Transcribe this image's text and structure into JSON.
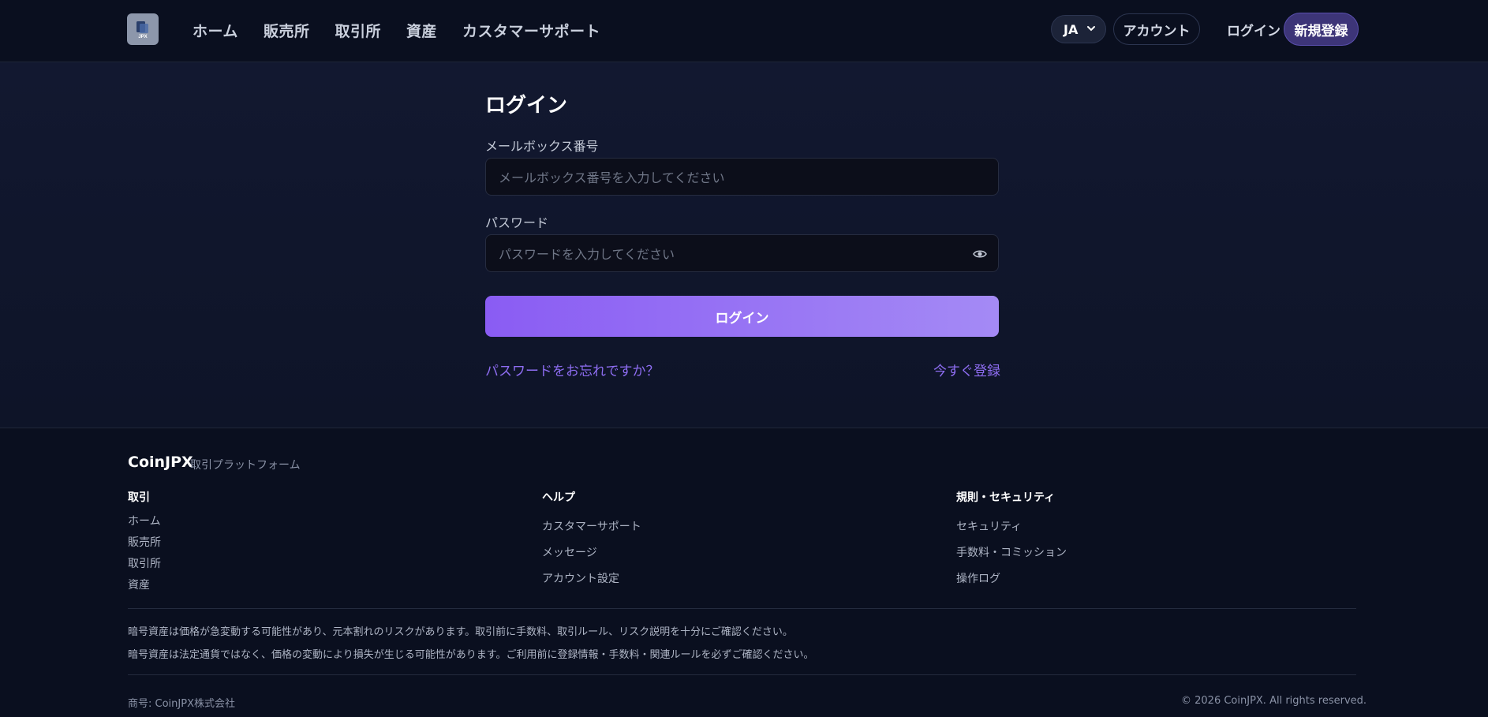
{
  "header": {
    "logo_text": "JPX",
    "nav": [
      "ホーム",
      "販売所",
      "取引所",
      "資産",
      "カスタマーサポート"
    ],
    "language": "JA",
    "account_label": "アカウント",
    "login_label": "ログイン",
    "register_label": "新規登録"
  },
  "login": {
    "title": "ログイン",
    "email_label": "メールボックス番号",
    "email_placeholder": "メールボックス番号を入力してください",
    "password_label": "パスワード",
    "password_placeholder": "パスワードを入力してください",
    "submit_label": "ログイン",
    "forgot_label": "パスワードをお忘れですか？",
    "signup_label": "今すぐ登録"
  },
  "footer": {
    "brand": "CoinJPX",
    "brand_sub": "取引プラットフォーム",
    "col1": {
      "title": "取引",
      "items": [
        "ホーム",
        "販売所",
        "取引所",
        "資産"
      ]
    },
    "col2": {
      "title": "ヘルプ",
      "items": [
        "カスタマーサポート",
        "メッセージ",
        "アカウント設定"
      ]
    },
    "col3": {
      "title": "規則・セキュリティ",
      "items": [
        "セキュリティ",
        "手数料・コミッション",
        "操作ログ"
      ]
    },
    "notice1": "暗号資産は価格が急変動する可能性があり、元本割れのリスクがあります。取引前に手数料、取引ルール、リスク説明を十分にご確認ください。",
    "notice2": "暗号資産は法定通貨ではなく、価格の変動により損失が生じる可能性があります。ご利用前に登録情報・手数料・関連ルールを必ずご確認ください。",
    "company": "商号: CoinJPX株式会社",
    "copyright": "© 2026 CoinJPX. All rights reserved."
  },
  "colors": {
    "accent": "#8a5cf3",
    "link": "#8e6df2",
    "background": "#0b1020"
  },
  "icons": [
    "chevron-down-icon",
    "eye-icon"
  ]
}
